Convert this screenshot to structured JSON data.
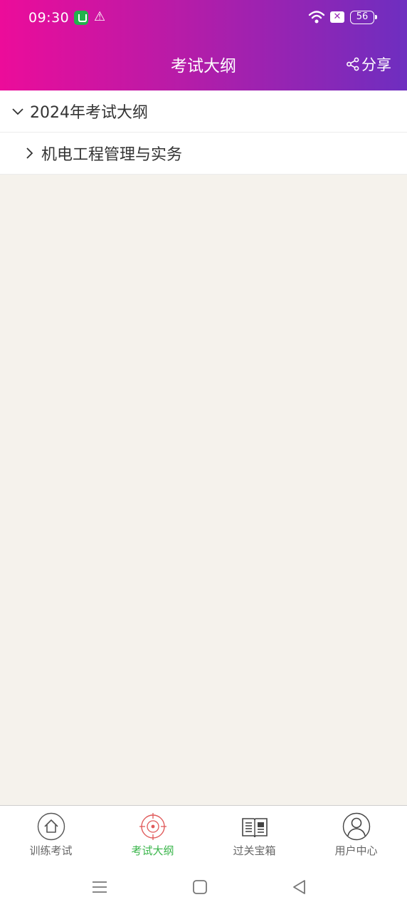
{
  "status_bar": {
    "time": "09:30",
    "battery": "56",
    "icons": [
      "app-notification-icon",
      "warning-icon",
      "wifi-icon",
      "sim-off-icon",
      "battery-icon"
    ]
  },
  "header": {
    "title": "考试大纲",
    "share_label": "分享",
    "gradient": [
      "#ec0c9a",
      "#6e2ec0"
    ]
  },
  "tree": {
    "items": [
      {
        "label": "2024年考试大纲",
        "expanded": true
      },
      {
        "label": "机电工程管理与实务",
        "expanded": false
      }
    ]
  },
  "tabs": [
    {
      "label": "训练考试",
      "icon": "home-icon",
      "active": false
    },
    {
      "label": "考试大纲",
      "icon": "target-icon",
      "active": true
    },
    {
      "label": "过关宝箱",
      "icon": "news-book-icon",
      "active": false
    },
    {
      "label": "用户中心",
      "icon": "user-icon",
      "active": false
    }
  ],
  "colors": {
    "active_tab": "#39b54a",
    "inactive_tab": "#666666",
    "content_bg": "#f5f2ec"
  }
}
